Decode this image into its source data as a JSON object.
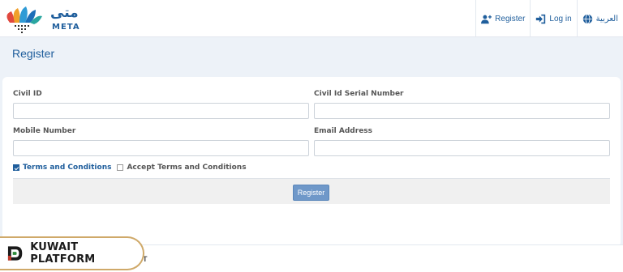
{
  "header": {
    "logo_text_arabic": "متى",
    "logo_text_latin": "META",
    "nav": {
      "register_label": "Register",
      "login_label": "Log in",
      "language_label": "العربية"
    }
  },
  "page": {
    "title": "Register"
  },
  "form": {
    "civil_id": {
      "label": "Civil ID",
      "value": "",
      "placeholder": ""
    },
    "civil_serial": {
      "label": "Civil Id Serial Number",
      "value": "",
      "placeholder": ""
    },
    "mobile": {
      "label": "Mobile Number",
      "value": "",
      "placeholder": ""
    },
    "email": {
      "label": "Email Address",
      "value": "",
      "placeholder": ""
    },
    "terms_link_label": "Terms and Conditions",
    "accept_terms_label": "Accept Terms and Conditions",
    "accept_terms_checked": false,
    "submit_label": "Register"
  },
  "footer": {
    "badge_label": "KUWAIT PLATFORM",
    "partial_text": "T"
  },
  "colors": {
    "accent": "#1f5e9c",
    "button": "#6f98c9",
    "badge_border": "#cfa969"
  }
}
